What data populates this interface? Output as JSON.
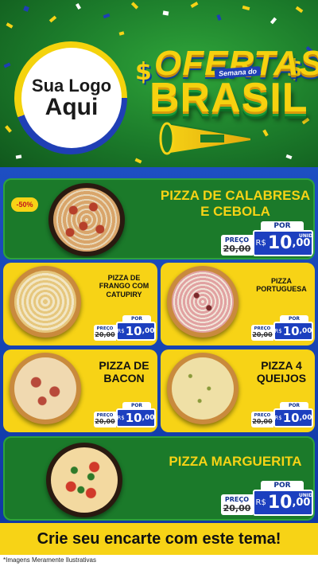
{
  "header": {
    "logo_line1": "Sua Logo",
    "logo_line2": "Aqui",
    "title_top": "OFERTAS",
    "title_sub": "Semana do",
    "title_bottom": "BRASIL",
    "dollar_symbol": "$"
  },
  "colors": {
    "brazil_green": "#1b7a2a",
    "brazil_yellow": "#f7d316",
    "brazil_blue": "#1c3fbf",
    "discount_red": "#c4161c"
  },
  "tag_labels": {
    "por": "POR",
    "preco": "PREÇO",
    "unid": "UNID",
    "currency": "R$"
  },
  "products": [
    {
      "name": "PIZZA DE CALABRESA E CEBOLA",
      "old_price": "20,00",
      "new_price_int": "10",
      "new_price_dec": ",00",
      "badge": "-50%"
    },
    {
      "name": "PIZZA DE FRANGO COM CATUPIRY",
      "old_price": "20,00",
      "new_price_int": "10",
      "new_price_dec": ",00"
    },
    {
      "name": "PIZZA PORTUGUESA",
      "old_price": "20,00",
      "new_price_int": "10",
      "new_price_dec": ",00"
    },
    {
      "name": "PIZZA DE BACON",
      "old_price": "20,00",
      "new_price_int": "10",
      "new_price_dec": ",00"
    },
    {
      "name": "PIZZA 4 QUEIJOS",
      "old_price": "20,00",
      "new_price_int": "10",
      "new_price_dec": ",00"
    },
    {
      "name": "PIZZA MARGUERITA",
      "old_price": "20,00",
      "new_price_int": "10",
      "new_price_dec": ",00"
    }
  ],
  "footer": {
    "cta": "Crie seu encarte com este tema!",
    "disclaimer": "*Imagens Meramente Ilustrativas"
  }
}
